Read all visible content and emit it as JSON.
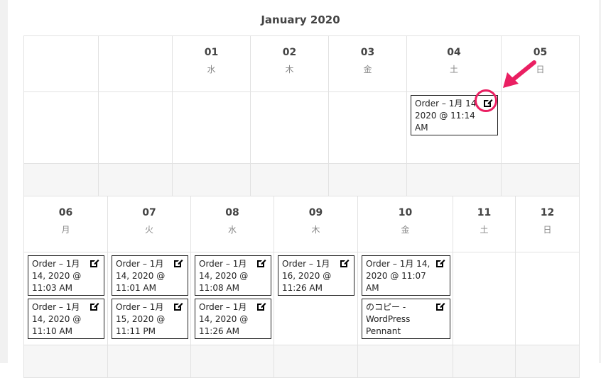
{
  "calendar": {
    "month_title": "January 2020",
    "weeks": [
      {
        "days": [
          {
            "num": "",
            "weekday": "",
            "events": []
          },
          {
            "num": "",
            "weekday": "",
            "events": []
          },
          {
            "num": "01",
            "weekday": "水",
            "events": []
          },
          {
            "num": "02",
            "weekday": "木",
            "events": []
          },
          {
            "num": "03",
            "weekday": "金",
            "events": []
          },
          {
            "num": "04",
            "weekday": "土",
            "events": [
              {
                "title": "Order – 1月 14, 2020 @ 11:14 AM"
              }
            ]
          },
          {
            "num": "05",
            "weekday": "日",
            "events": []
          }
        ]
      },
      {
        "days": [
          {
            "num": "06",
            "weekday": "月",
            "events": [
              {
                "title": "Order – 1月 14, 2020 @ 11:03 AM"
              },
              {
                "title": "Order – 1月 14, 2020 @ 11:10 AM"
              }
            ]
          },
          {
            "num": "07",
            "weekday": "火",
            "events": [
              {
                "title": "Order – 1月 14, 2020 @ 11:01 AM"
              },
              {
                "title": "Order – 1月 15, 2020 @ 11:11 PM"
              }
            ]
          },
          {
            "num": "08",
            "weekday": "水",
            "events": [
              {
                "title": "Order – 1月 14, 2020 @ 11:08 AM"
              },
              {
                "title": "Order – 1月 14, 2020 @ 11:26 AM"
              }
            ]
          },
          {
            "num": "09",
            "weekday": "木",
            "events": [
              {
                "title": "Order – 1月 16, 2020 @ 11:26 AM"
              }
            ]
          },
          {
            "num": "10",
            "weekday": "金",
            "events": [
              {
                "title": "Order – 1月 14, 2020 @ 11:07 AM"
              },
              {
                "title": "のコピー - WordPress Pennant"
              }
            ]
          },
          {
            "num": "11",
            "weekday": "土",
            "events": []
          },
          {
            "num": "12",
            "weekday": "日",
            "events": []
          }
        ]
      }
    ]
  },
  "colors": {
    "highlight": "#ea1f62",
    "border": "#e2e2e2",
    "event_border": "#222222"
  },
  "icons": {
    "edit": "edit-note-icon",
    "annotation_arrow": "arrow-icon",
    "annotation_ring": "highlight-circle"
  }
}
